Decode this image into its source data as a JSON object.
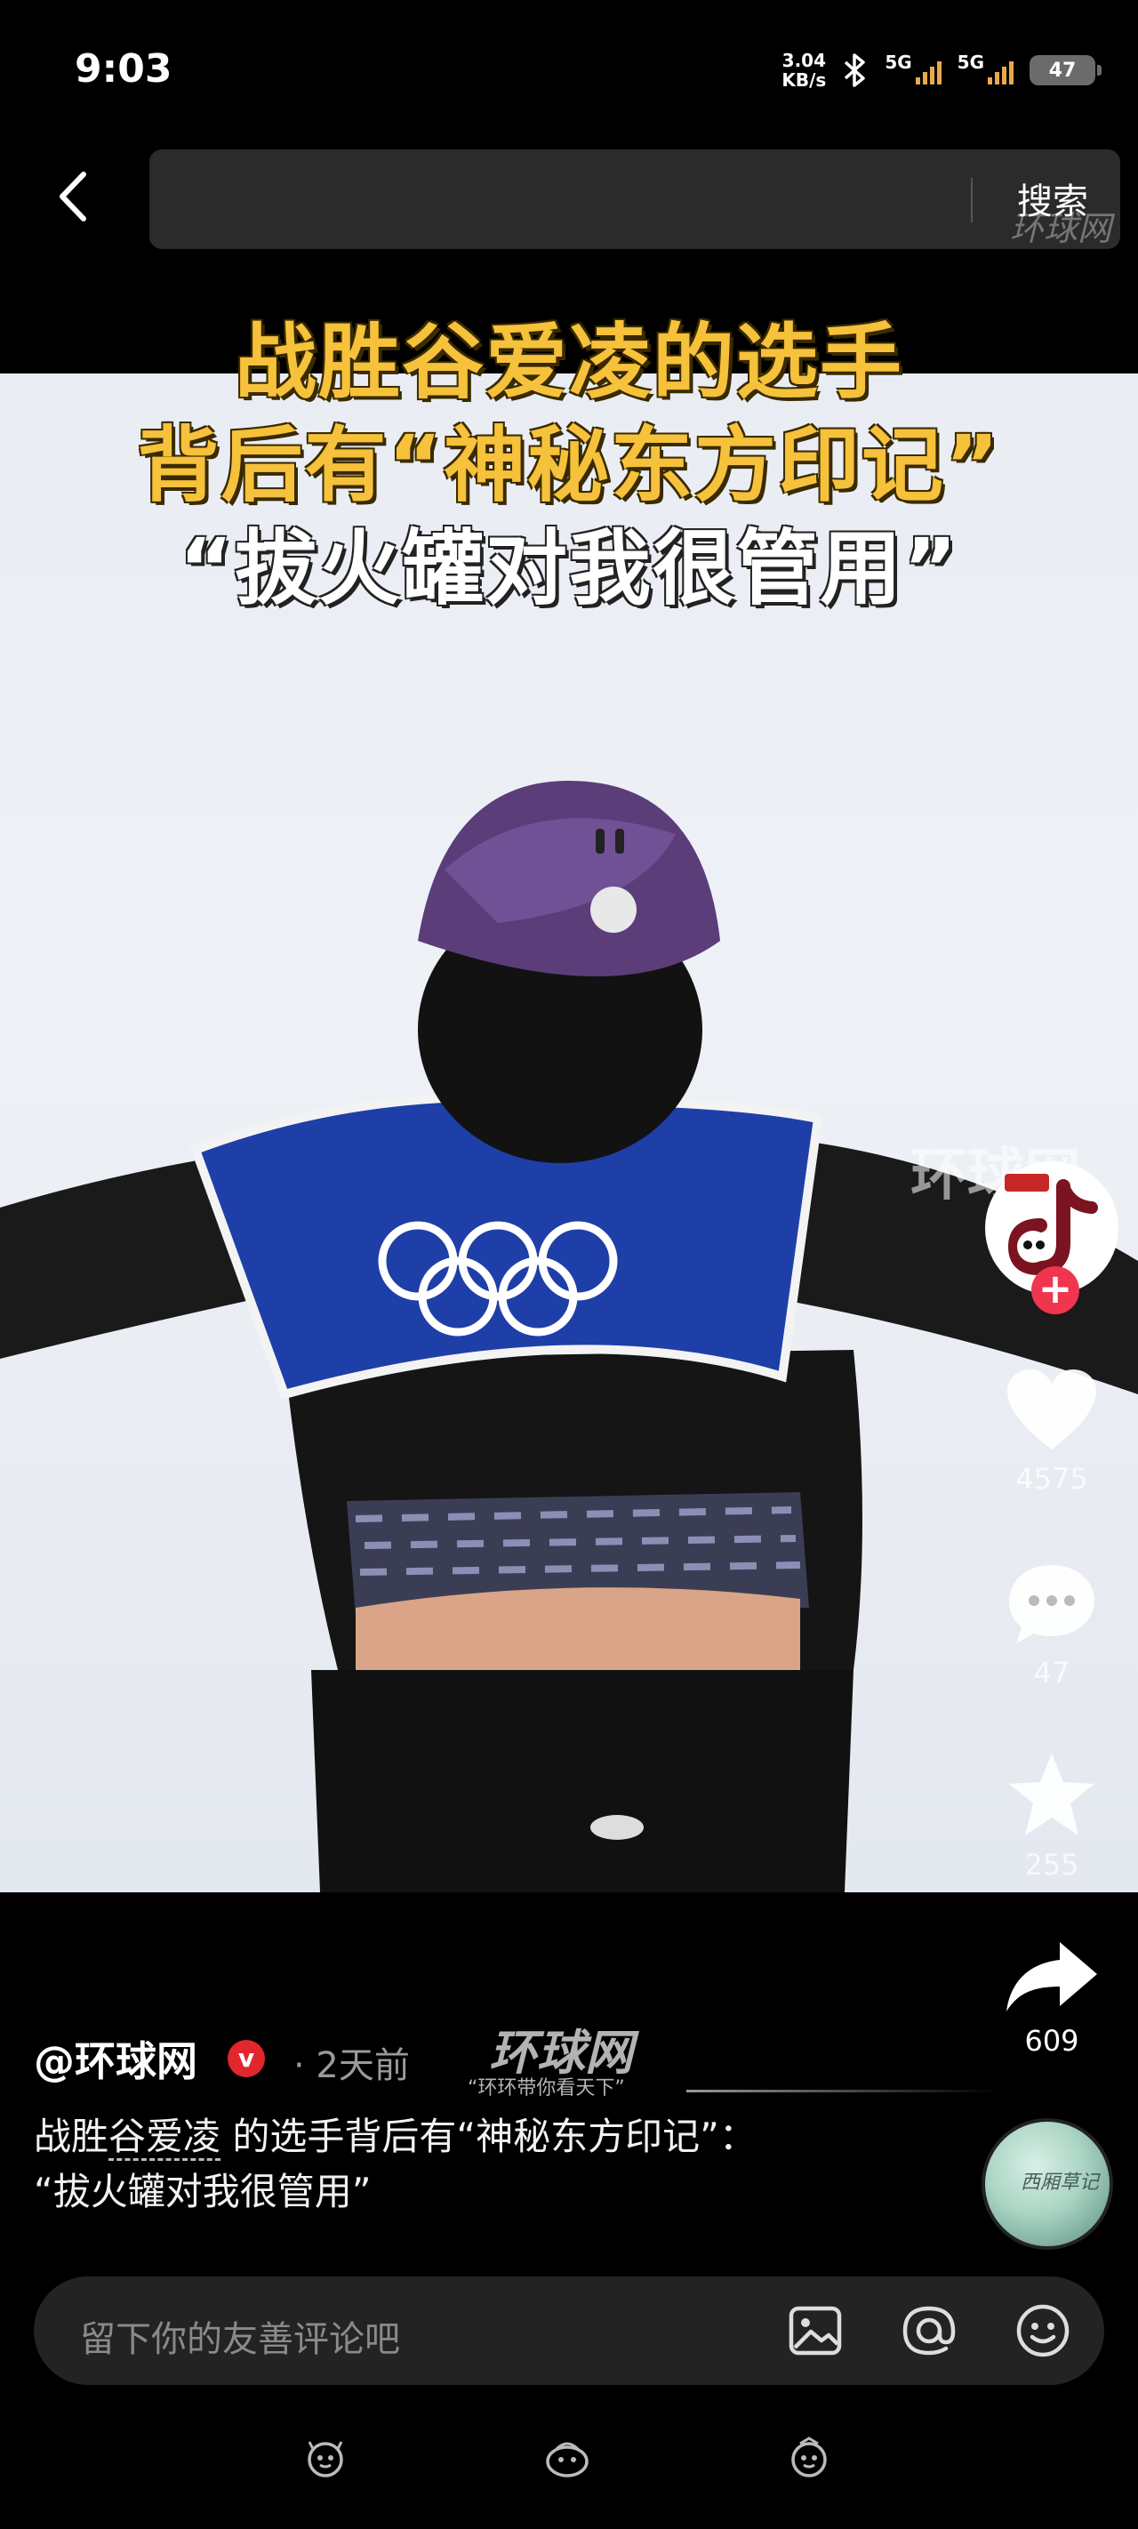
{
  "status_bar": {
    "time": "9:03",
    "net_speed_value": "3.04",
    "net_speed_unit": "KB/s",
    "sim1_label": "5G",
    "sim2_label": "5G",
    "battery": "47"
  },
  "search": {
    "placeholder": "",
    "button_label": "搜索",
    "watermark": "环球网"
  },
  "video": {
    "headline_line1": "战胜谷爱凌的选手",
    "headline_line2": "背后有“神秘东方印记”",
    "headline_line3": "“拔火罐对我很管用”",
    "watermark": "环球网"
  },
  "actions": {
    "likes": "4575",
    "comments": "47",
    "favorites": "255",
    "shares": "609"
  },
  "post": {
    "author": "@环球网",
    "verified_mark": "v",
    "time": "· 2天前",
    "watermark_title": "环球网",
    "watermark_sub": "“环环带你看天下”",
    "caption_name": "谷爱凌",
    "caption_prefix": "战胜",
    "caption_rest": " 的选手背后有“神秘东方印记”：",
    "caption_line2": "“拔火罐对我很管用”",
    "music_cover_text": "西厢草记"
  },
  "comment_bar": {
    "placeholder": "留下你的友善评论吧"
  },
  "colors": {
    "headline_yellow": "#f6c13b",
    "follow_red": "#f0364f",
    "vest_blue": "#1f3fa8"
  }
}
